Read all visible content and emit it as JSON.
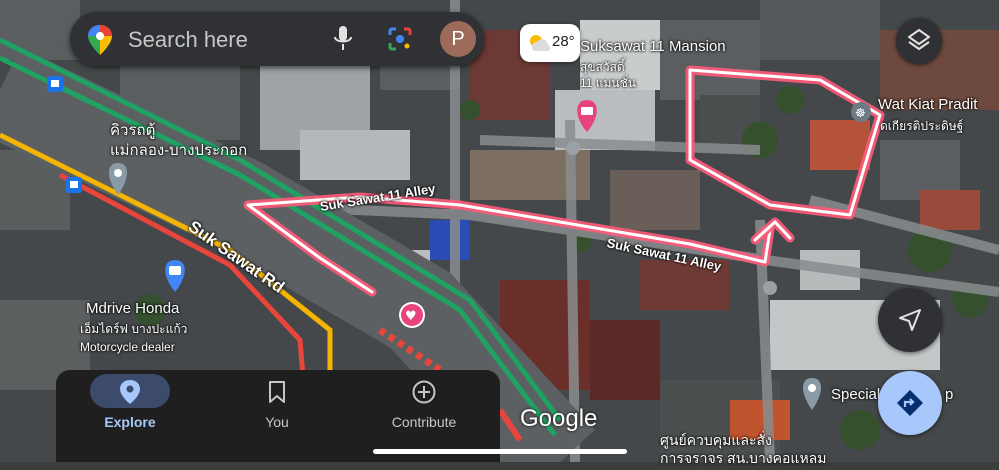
{
  "search": {
    "placeholder": "Search here",
    "avatar_letter": "P"
  },
  "weather": {
    "temperature": "28°",
    "icon": "partly-cloudy-icon"
  },
  "labels": {
    "mansion_en": "Suksawat 11 Mansion",
    "mansion_th1": "สุขสวัสดิ์",
    "mansion_th2": "11 แมนชั่น",
    "wat_en": "Wat Kiat Pradit",
    "wat_th": "ดเกียรติประดิษฐ์",
    "queue_th1": "คิวรถตู้",
    "queue_th2": "แม่กลอง-บางประกอก",
    "road_main": "Suk Sawat Rd",
    "alley_1": "Suk Sawat 11 Alley",
    "alley_2": "Suk Sawat 11 Alley",
    "mdrive_en": "Mdrive Honda",
    "mdrive_th": "เอ็มไดร์ฟ บางปะแก้ว",
    "mdrive_cat": "Motorcycle dealer",
    "special": "Special",
    "special_tail": "p",
    "center_th1": "ศูนย์ควบคุมและสั่ง",
    "center_th2": "การจราจร สน.บางคอแหลม",
    "google": "Google"
  },
  "tabs": [
    {
      "label": "Explore",
      "icon": "explore-pin-icon",
      "active": true
    },
    {
      "label": "You",
      "icon": "bookmark-icon",
      "active": false
    },
    {
      "label": "Contribute",
      "icon": "add-circle-icon",
      "active": false
    }
  ],
  "colors": {
    "accent": "#a8c7fa",
    "route": "#ff5a7a",
    "traffic_red": "#e8453c",
    "traffic_green": "#1ea362",
    "traffic_yellow": "#f4b400"
  }
}
